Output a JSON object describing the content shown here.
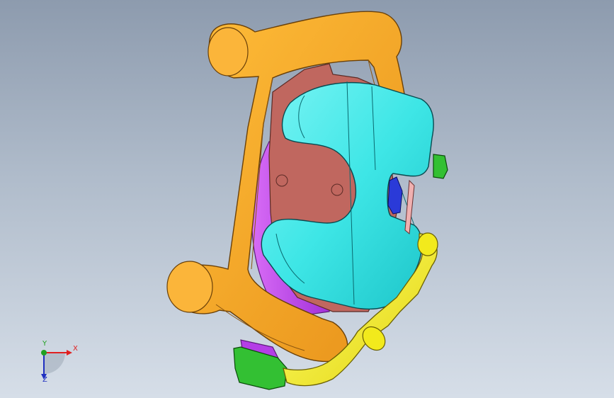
{
  "triad": {
    "x_label": "X",
    "y_label": "Y",
    "z_label": "Z"
  },
  "colors": {
    "background_top": "#8d9bae",
    "background_bottom": "#d6dee8",
    "bracket": "#f5a623",
    "piston_body": "#3ee6e6",
    "brake_pad": "#c0675f",
    "rotor_shield": "#b43ee6",
    "hose": "#f2ea1c",
    "fitting": "#33c033",
    "axis_x": "#e02020",
    "axis_y": "#20a020",
    "axis_z": "#2030c0"
  },
  "parts": [
    "caliper-bracket",
    "caliper-body",
    "brake-pad",
    "rotor-shield",
    "brake-hose",
    "bleeder-fitting"
  ]
}
